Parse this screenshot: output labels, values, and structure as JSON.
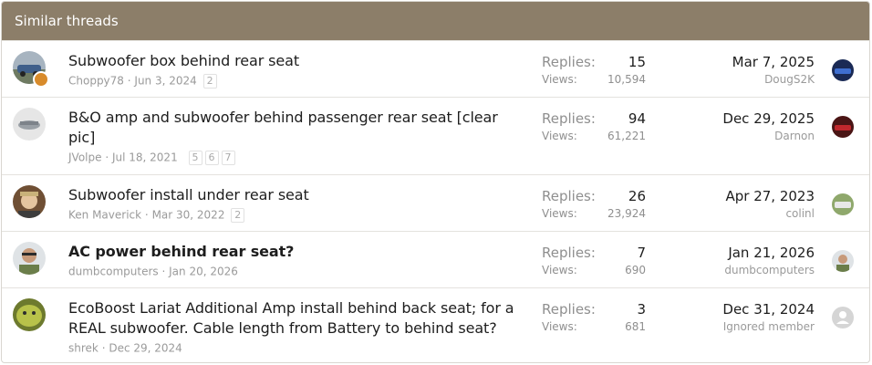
{
  "header": {
    "title": "Similar threads"
  },
  "labels": {
    "replies": "Replies:",
    "views": "Views:"
  },
  "threads": [
    {
      "title_line1": "Subwoofer box behind rear seat",
      "title_line2": "",
      "author": "Choppy78",
      "date": "Jun 3, 2024",
      "pages": [
        "2"
      ],
      "replies": "15",
      "views": "10,594",
      "last_date": "Mar 7, 2025",
      "last_user": "DougS2K"
    },
    {
      "title_line1": "B&O amp and subwoofer behind passenger rear seat [clear",
      "title_line2": "pic]",
      "author": "JVolpe",
      "date": "Jul 18, 2021",
      "pages": [
        "5",
        "6",
        "7"
      ],
      "replies": "94",
      "views": "61,221",
      "last_date": "Dec 29, 2025",
      "last_user": "Darnon"
    },
    {
      "title_line1": "Subwoofer install under rear seat",
      "title_line2": "",
      "author": "Ken Maverick",
      "date": "Mar 30, 2022",
      "pages": [
        "2"
      ],
      "replies": "26",
      "views": "23,924",
      "last_date": "Apr 27, 2023",
      "last_user": "colinl"
    },
    {
      "title_line1": "AC power behind rear seat?",
      "title_line2": "",
      "author": "dumbcomputers",
      "date": "Jan 20, 2026",
      "pages": [],
      "replies": "7",
      "views": "690",
      "last_date": "Jan 21, 2026",
      "last_user": "dumbcomputers"
    },
    {
      "title_line1": "EcoBoost Lariat Additional Amp install behind back seat; for a",
      "title_line2": "REAL subwoofer. Cable length from Battery to behind seat?",
      "author": "shrek",
      "date": "Dec 29, 2024",
      "pages": [],
      "replies": "3",
      "views": "681",
      "last_date": "Dec 31, 2024",
      "last_user": "Ignored member"
    }
  ],
  "colors": {
    "header_bg": "#8c7e69",
    "text": "#1d1d1d",
    "muted": "#9a9a9a"
  }
}
